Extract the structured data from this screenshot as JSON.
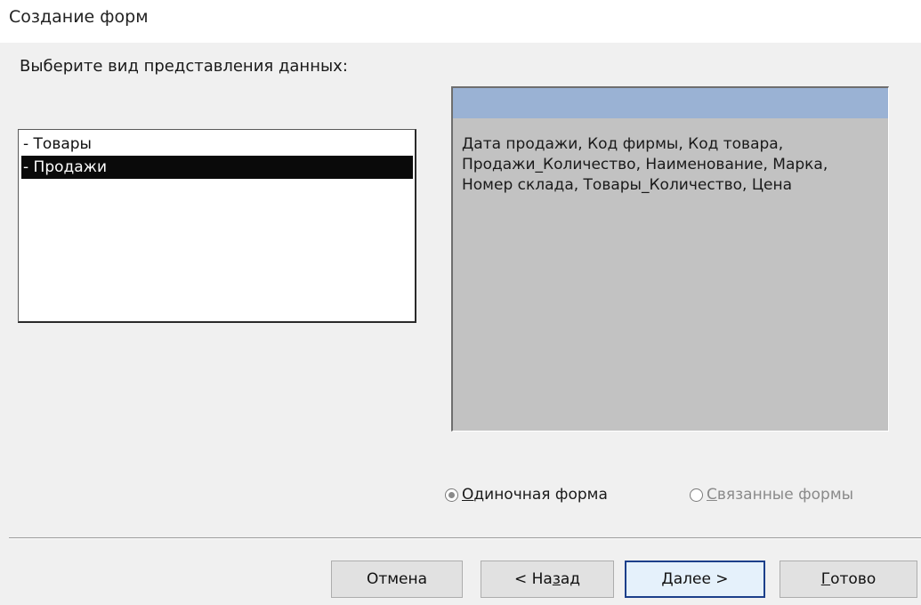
{
  "window": {
    "title": "Создание форм"
  },
  "prompt": "Выберите вид представления данных:",
  "list": {
    "items": [
      {
        "label": "- Товары",
        "selected": false
      },
      {
        "label": "- Продажи",
        "selected": true
      }
    ]
  },
  "preview": {
    "fields_text": "Дата продажи, Код фирмы, Код товара, Продажи_Количество, Наименование, Марка, Номер склада, Товары_Количество, Цена"
  },
  "options": {
    "single": {
      "mnemonic": "О",
      "rest": "диночная форма",
      "checked": true
    },
    "linked": {
      "mnemonic": "С",
      "rest": "вязанные формы",
      "enabled": false
    }
  },
  "buttons": {
    "cancel": {
      "label": "Отмена"
    },
    "back": {
      "pre": "< На",
      "mnemonic": "з",
      "post": "ад"
    },
    "next": {
      "mnemonic": "Д",
      "post": "алее >"
    },
    "finish": {
      "mnemonic": "Г",
      "post": "отово"
    }
  },
  "colors": {
    "panel_bg": "#f0f0f0",
    "preview_bg": "#c2c2c2",
    "preview_header": "#9ab2d4",
    "selection_bg": "#0a0a0a",
    "default_button_border": "#1c3f8a"
  }
}
